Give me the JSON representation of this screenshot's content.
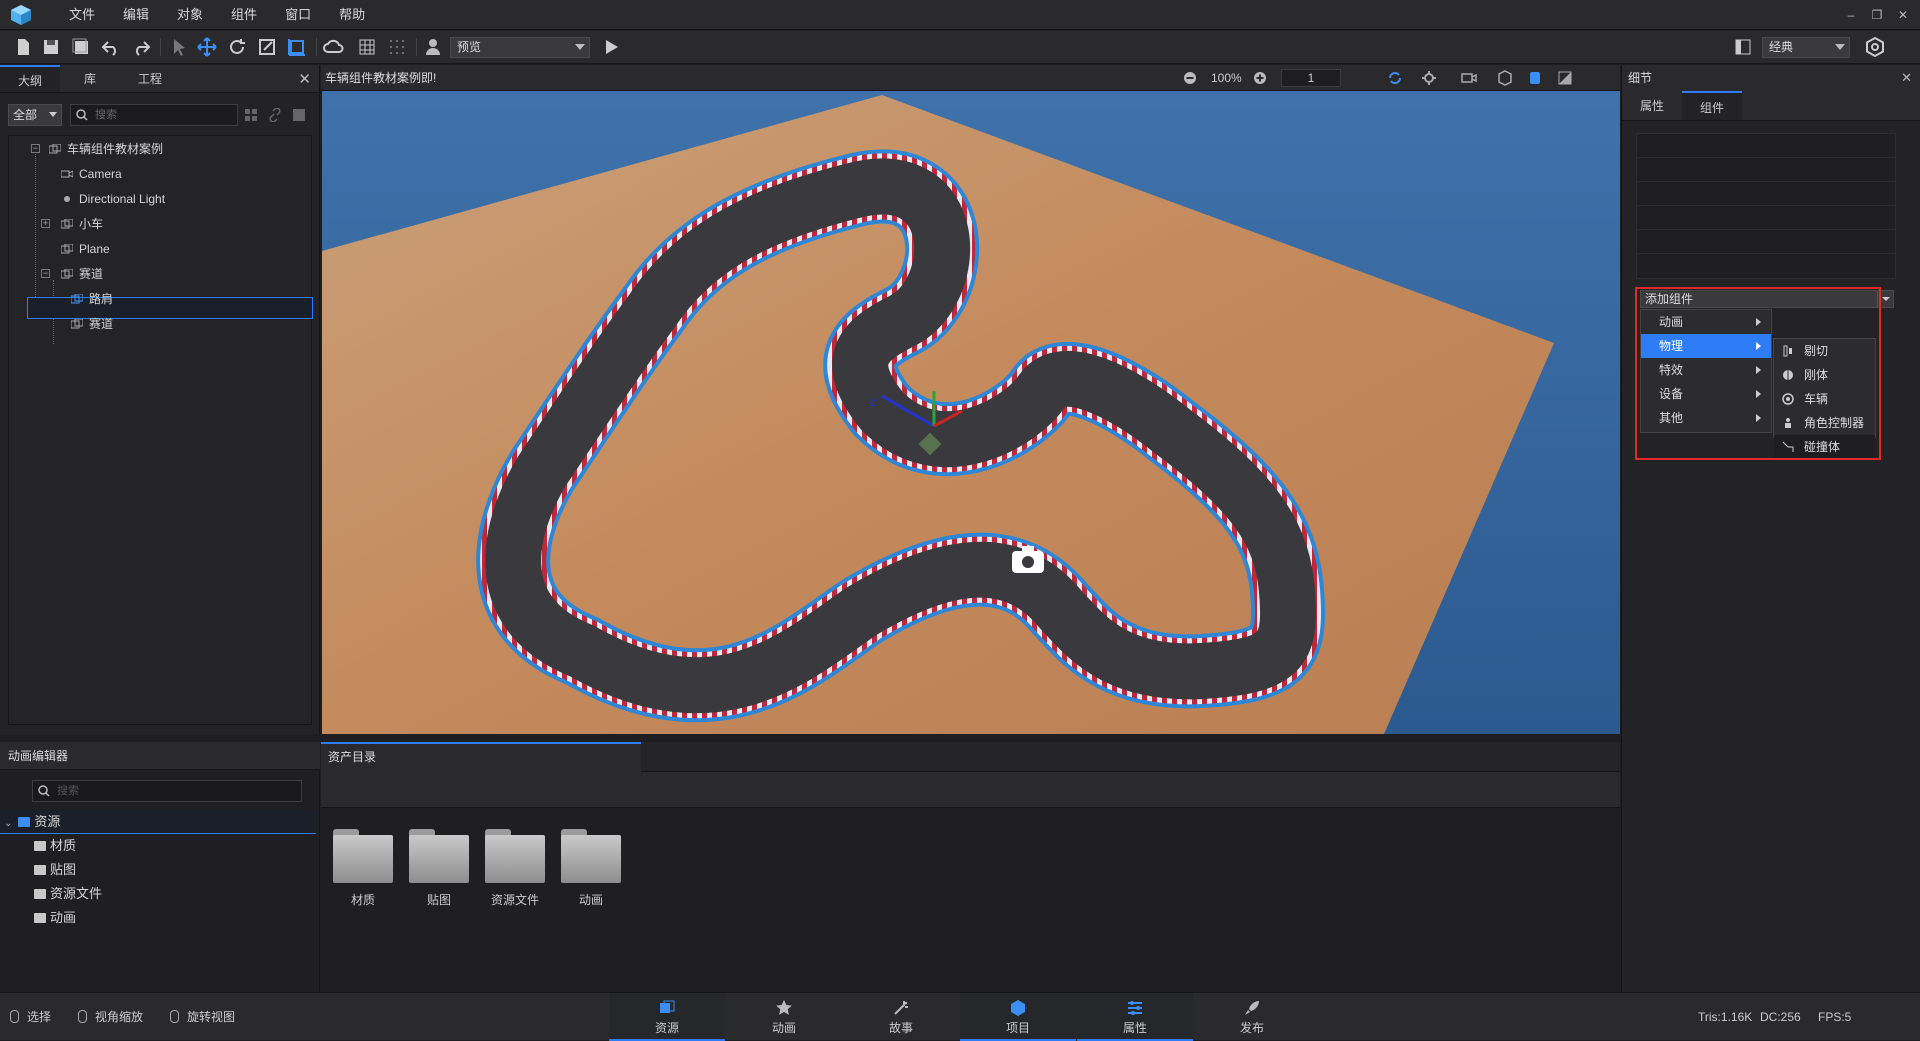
{
  "menu": [
    "文件",
    "编辑",
    "对象",
    "组件",
    "窗口",
    "帮助"
  ],
  "toolbar": {
    "preview_label": "预览",
    "layout_label": "经典"
  },
  "outline": {
    "tabs": [
      "大纲",
      "库",
      "工程"
    ],
    "filter": "全部",
    "search_placeholder": "搜索",
    "tree": [
      "车辆组件教材案例",
      "Camera",
      "Directional Light",
      "小车",
      "Plane",
      "赛道",
      "路肩",
      "赛道"
    ]
  },
  "viewport": {
    "title": "车辆组件教材案例即!",
    "zoom": "100%",
    "number": "1"
  },
  "detail": {
    "title": "细节",
    "tabs": [
      "属性",
      "组件"
    ],
    "add_component": "添加组件",
    "menu": [
      "动画",
      "物理",
      "特效",
      "设备",
      "其他"
    ],
    "physics_submenu": [
      "剔切",
      "刚体",
      "车辆",
      "角色控制器",
      "碰撞体"
    ]
  },
  "anim": {
    "title": "动画编辑器",
    "search_placeholder": "搜索",
    "root": "资源",
    "children": [
      "材质",
      "贴图",
      "资源文件",
      "动画"
    ]
  },
  "assets": {
    "tab": "资产目录",
    "folders": [
      "材质",
      "贴图",
      "资源文件",
      "动画"
    ]
  },
  "status": {
    "hints": [
      "选择",
      "视角缩放",
      "旋转视图"
    ],
    "nav": [
      "资源",
      "动画",
      "故事",
      "项目",
      "属性",
      "发布"
    ],
    "stats": [
      "Tris:1.16K",
      "DC:256",
      "FPS:5"
    ]
  },
  "colors": {
    "accent": "#2f7df6",
    "highlight_box": "#e02a2a",
    "ground": "#c4855a",
    "sky": "#3b6da5"
  }
}
